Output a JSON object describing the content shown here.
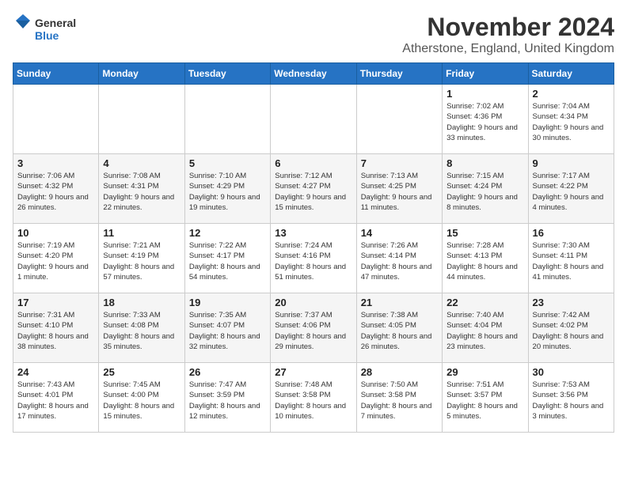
{
  "logo": {
    "line1": "General",
    "line2": "Blue"
  },
  "title": "November 2024",
  "location": "Atherstone, England, United Kingdom",
  "days_header": [
    "Sunday",
    "Monday",
    "Tuesday",
    "Wednesday",
    "Thursday",
    "Friday",
    "Saturday"
  ],
  "weeks": [
    [
      {
        "day": "",
        "info": ""
      },
      {
        "day": "",
        "info": ""
      },
      {
        "day": "",
        "info": ""
      },
      {
        "day": "",
        "info": ""
      },
      {
        "day": "",
        "info": ""
      },
      {
        "day": "1",
        "info": "Sunrise: 7:02 AM\nSunset: 4:36 PM\nDaylight: 9 hours and 33 minutes."
      },
      {
        "day": "2",
        "info": "Sunrise: 7:04 AM\nSunset: 4:34 PM\nDaylight: 9 hours and 30 minutes."
      }
    ],
    [
      {
        "day": "3",
        "info": "Sunrise: 7:06 AM\nSunset: 4:32 PM\nDaylight: 9 hours and 26 minutes."
      },
      {
        "day": "4",
        "info": "Sunrise: 7:08 AM\nSunset: 4:31 PM\nDaylight: 9 hours and 22 minutes."
      },
      {
        "day": "5",
        "info": "Sunrise: 7:10 AM\nSunset: 4:29 PM\nDaylight: 9 hours and 19 minutes."
      },
      {
        "day": "6",
        "info": "Sunrise: 7:12 AM\nSunset: 4:27 PM\nDaylight: 9 hours and 15 minutes."
      },
      {
        "day": "7",
        "info": "Sunrise: 7:13 AM\nSunset: 4:25 PM\nDaylight: 9 hours and 11 minutes."
      },
      {
        "day": "8",
        "info": "Sunrise: 7:15 AM\nSunset: 4:24 PM\nDaylight: 9 hours and 8 minutes."
      },
      {
        "day": "9",
        "info": "Sunrise: 7:17 AM\nSunset: 4:22 PM\nDaylight: 9 hours and 4 minutes."
      }
    ],
    [
      {
        "day": "10",
        "info": "Sunrise: 7:19 AM\nSunset: 4:20 PM\nDaylight: 9 hours and 1 minute."
      },
      {
        "day": "11",
        "info": "Sunrise: 7:21 AM\nSunset: 4:19 PM\nDaylight: 8 hours and 57 minutes."
      },
      {
        "day": "12",
        "info": "Sunrise: 7:22 AM\nSunset: 4:17 PM\nDaylight: 8 hours and 54 minutes."
      },
      {
        "day": "13",
        "info": "Sunrise: 7:24 AM\nSunset: 4:16 PM\nDaylight: 8 hours and 51 minutes."
      },
      {
        "day": "14",
        "info": "Sunrise: 7:26 AM\nSunset: 4:14 PM\nDaylight: 8 hours and 47 minutes."
      },
      {
        "day": "15",
        "info": "Sunrise: 7:28 AM\nSunset: 4:13 PM\nDaylight: 8 hours and 44 minutes."
      },
      {
        "day": "16",
        "info": "Sunrise: 7:30 AM\nSunset: 4:11 PM\nDaylight: 8 hours and 41 minutes."
      }
    ],
    [
      {
        "day": "17",
        "info": "Sunrise: 7:31 AM\nSunset: 4:10 PM\nDaylight: 8 hours and 38 minutes."
      },
      {
        "day": "18",
        "info": "Sunrise: 7:33 AM\nSunset: 4:08 PM\nDaylight: 8 hours and 35 minutes."
      },
      {
        "day": "19",
        "info": "Sunrise: 7:35 AM\nSunset: 4:07 PM\nDaylight: 8 hours and 32 minutes."
      },
      {
        "day": "20",
        "info": "Sunrise: 7:37 AM\nSunset: 4:06 PM\nDaylight: 8 hours and 29 minutes."
      },
      {
        "day": "21",
        "info": "Sunrise: 7:38 AM\nSunset: 4:05 PM\nDaylight: 8 hours and 26 minutes."
      },
      {
        "day": "22",
        "info": "Sunrise: 7:40 AM\nSunset: 4:04 PM\nDaylight: 8 hours and 23 minutes."
      },
      {
        "day": "23",
        "info": "Sunrise: 7:42 AM\nSunset: 4:02 PM\nDaylight: 8 hours and 20 minutes."
      }
    ],
    [
      {
        "day": "24",
        "info": "Sunrise: 7:43 AM\nSunset: 4:01 PM\nDaylight: 8 hours and 17 minutes."
      },
      {
        "day": "25",
        "info": "Sunrise: 7:45 AM\nSunset: 4:00 PM\nDaylight: 8 hours and 15 minutes."
      },
      {
        "day": "26",
        "info": "Sunrise: 7:47 AM\nSunset: 3:59 PM\nDaylight: 8 hours and 12 minutes."
      },
      {
        "day": "27",
        "info": "Sunrise: 7:48 AM\nSunset: 3:58 PM\nDaylight: 8 hours and 10 minutes."
      },
      {
        "day": "28",
        "info": "Sunrise: 7:50 AM\nSunset: 3:58 PM\nDaylight: 8 hours and 7 minutes."
      },
      {
        "day": "29",
        "info": "Sunrise: 7:51 AM\nSunset: 3:57 PM\nDaylight: 8 hours and 5 minutes."
      },
      {
        "day": "30",
        "info": "Sunrise: 7:53 AM\nSunset: 3:56 PM\nDaylight: 8 hours and 3 minutes."
      }
    ]
  ]
}
